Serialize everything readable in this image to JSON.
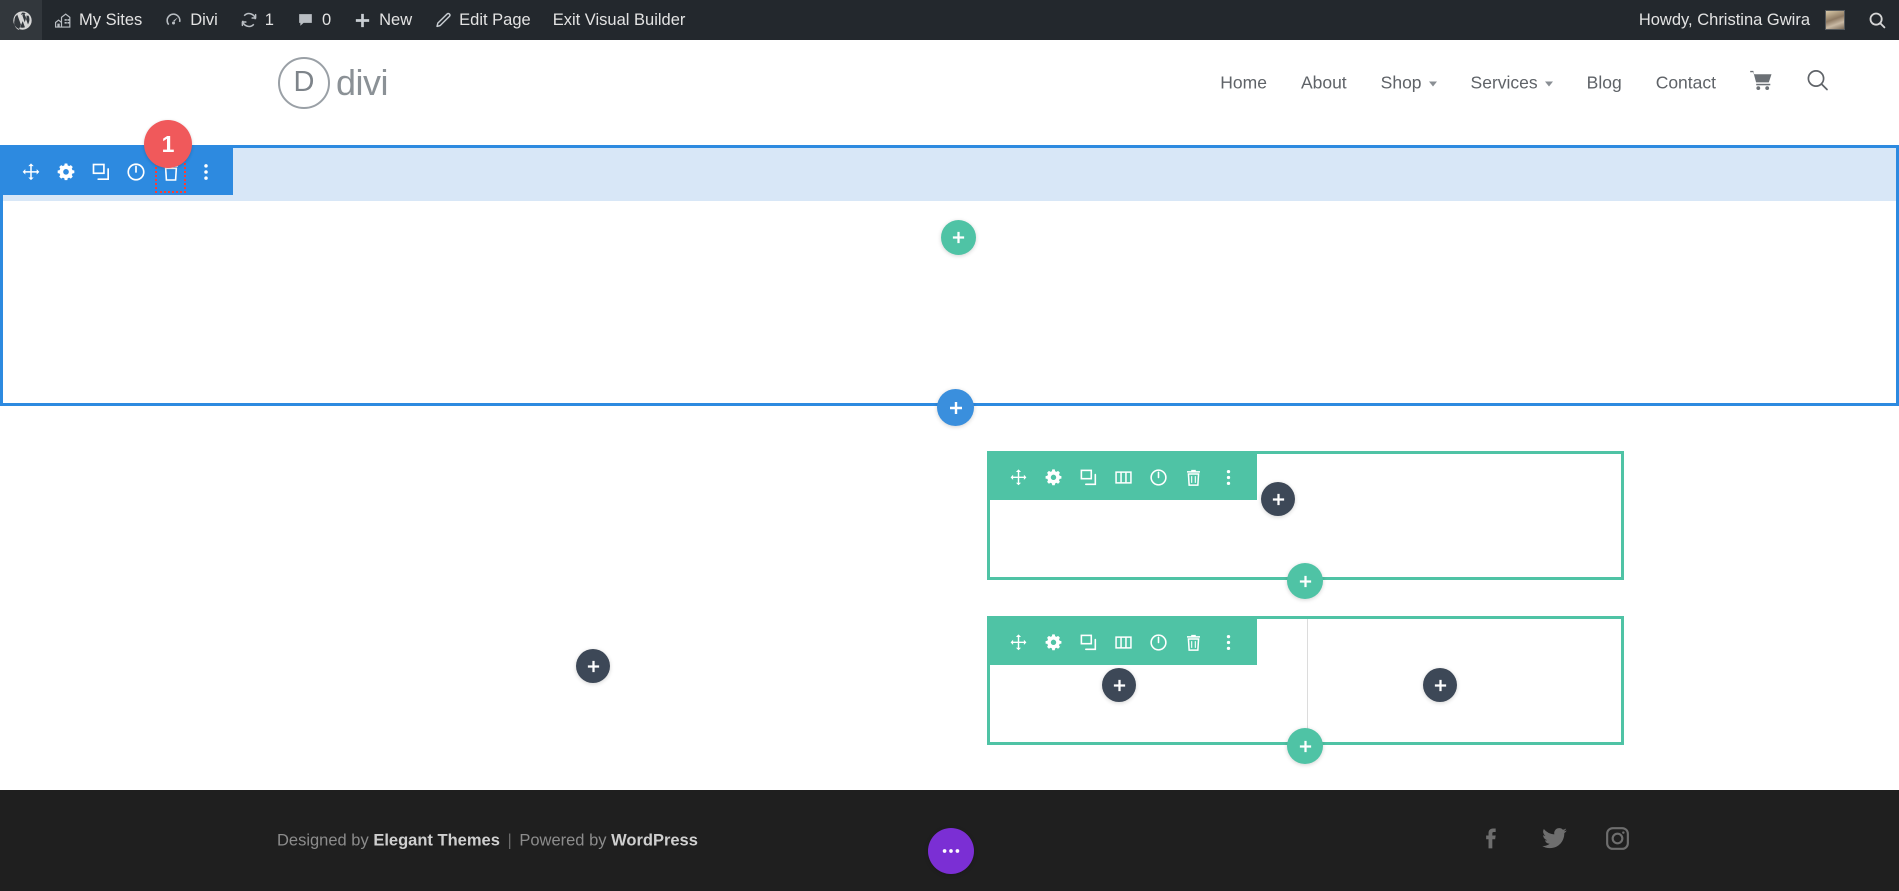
{
  "admin_bar": {
    "left_items": [
      {
        "id": "wp-logo",
        "label": "",
        "icon": "wordpress-icon"
      },
      {
        "id": "my-sites",
        "label": "My Sites",
        "icon": "sites-icon"
      },
      {
        "id": "divi",
        "label": "Divi",
        "icon": "divi-dashboard-icon"
      },
      {
        "id": "updates",
        "label": "1",
        "icon": "updates-icon"
      },
      {
        "id": "comments",
        "label": "0",
        "icon": "comment-bubble-icon"
      },
      {
        "id": "new",
        "label": "New",
        "icon": "plus-icon"
      },
      {
        "id": "edit-page",
        "label": "Edit Page",
        "icon": "pencil-icon"
      },
      {
        "id": "exit-builder",
        "label": "Exit Visual Builder",
        "icon": ""
      }
    ],
    "howdy": "Howdy, Christina Gwira",
    "search_icon": "search-icon"
  },
  "header": {
    "logo_letter": "D",
    "logo_text": "divi",
    "badge": "1",
    "nav": [
      {
        "label": "Home",
        "has_caret": false
      },
      {
        "label": "About",
        "has_caret": false
      },
      {
        "label": "Shop",
        "has_caret": true
      },
      {
        "label": "Services",
        "has_caret": true
      },
      {
        "label": "Blog",
        "has_caret": false
      },
      {
        "label": "Contact",
        "has_caret": false
      }
    ],
    "cart_icon": "shopping-cart-icon",
    "search_icon": "search-icon"
  },
  "builder": {
    "section_toolbar_icons": [
      "move-icon",
      "gear-icon",
      "duplicate-icon",
      "power-icon",
      "trash-icon",
      "more-options-icon"
    ],
    "row_toolbar_icons": [
      "move-icon",
      "gear-icon",
      "duplicate-icon",
      "columns-icon",
      "power-icon",
      "trash-icon",
      "more-options-icon"
    ],
    "focused_icon": "trash-icon",
    "add_module_label": "+",
    "add_row_label": "+",
    "add_section_label": "+",
    "page_settings_label": "•••"
  },
  "colors": {
    "section_accent": "#2d8ae0",
    "section_highlight": "#d8e7f7",
    "row_accent": "#4fc3a5",
    "module_add": "#3d4857",
    "page_settings": "#7b2fd4",
    "badge": "#f0595b",
    "admin_bar": "#23282d",
    "footer_bg": "#1f1f1f"
  },
  "footer": {
    "designed_by": "Designed by",
    "elegant_themes": "Elegant Themes",
    "separator": "|",
    "powered_by": "Powered by",
    "wordpress": "WordPress",
    "social": [
      "facebook-icon",
      "twitter-icon",
      "instagram-icon"
    ]
  }
}
